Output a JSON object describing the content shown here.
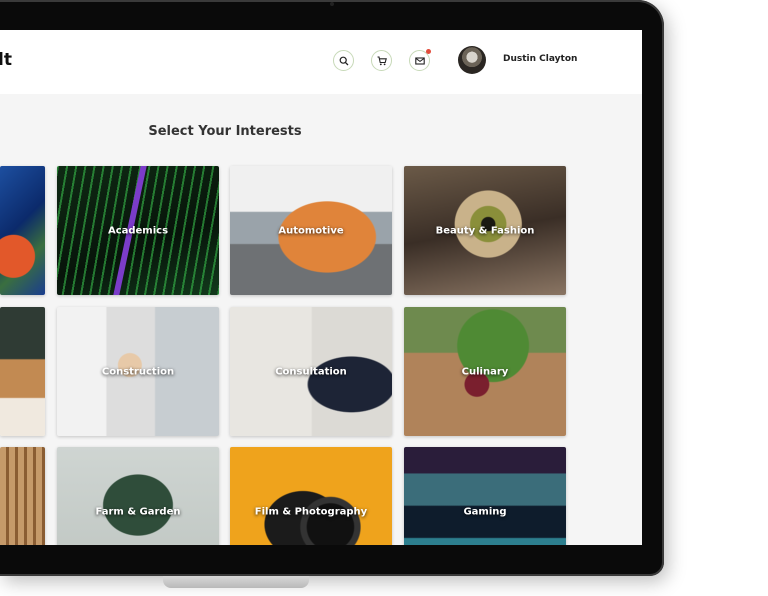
{
  "header": {
    "brand_fragment": "lt",
    "icons": [
      "search-icon",
      "cart-icon",
      "mail-icon"
    ],
    "notification_color": "#e24c3c",
    "user_name": "Dustin Clayton"
  },
  "main": {
    "title": "Select Your Interests",
    "interests": [
      {
        "label": "",
        "id": "art"
      },
      {
        "label": "Academics",
        "id": "academics"
      },
      {
        "label": "Automotive",
        "id": "automotive"
      },
      {
        "label": "Beauty & Fashion",
        "id": "beauty"
      },
      {
        "label": "",
        "id": "hotel"
      },
      {
        "label": "Construction",
        "id": "construction"
      },
      {
        "label": "Consultation",
        "id": "consultation"
      },
      {
        "label": "Culinary",
        "id": "culinary"
      },
      {
        "label": "",
        "id": "wood"
      },
      {
        "label": "Farm & Garden",
        "id": "farm"
      },
      {
        "label": "Film & Photography",
        "id": "film"
      },
      {
        "label": "Gaming",
        "id": "gaming"
      }
    ]
  },
  "colors": {
    "icon_border": "#c7d9b8",
    "screen_bg": "#f5f5f5"
  }
}
